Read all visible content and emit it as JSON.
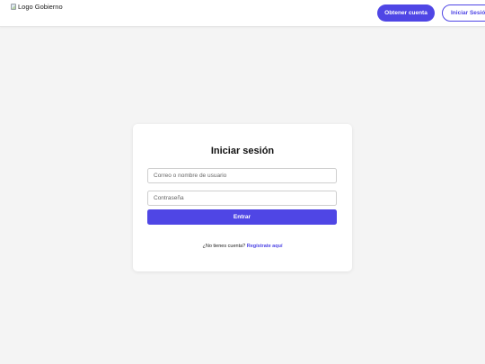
{
  "header": {
    "logo_alt": "Logo Gobierno",
    "obtain_account_label": "Obtener cuenta",
    "login_label": "Iniciar Sesión"
  },
  "login_card": {
    "title": "Iniciar sesión",
    "username_placeholder": "Correo o nombre de usuario",
    "password_placeholder": "Contraseña",
    "submit_label": "Entrar",
    "no_account_text": "¿No tienes cuenta?",
    "register_link_text": "Regístrate aquí"
  },
  "colors": {
    "accent": "#4f46e5",
    "background": "#f4f4f4",
    "card": "#ffffff"
  }
}
